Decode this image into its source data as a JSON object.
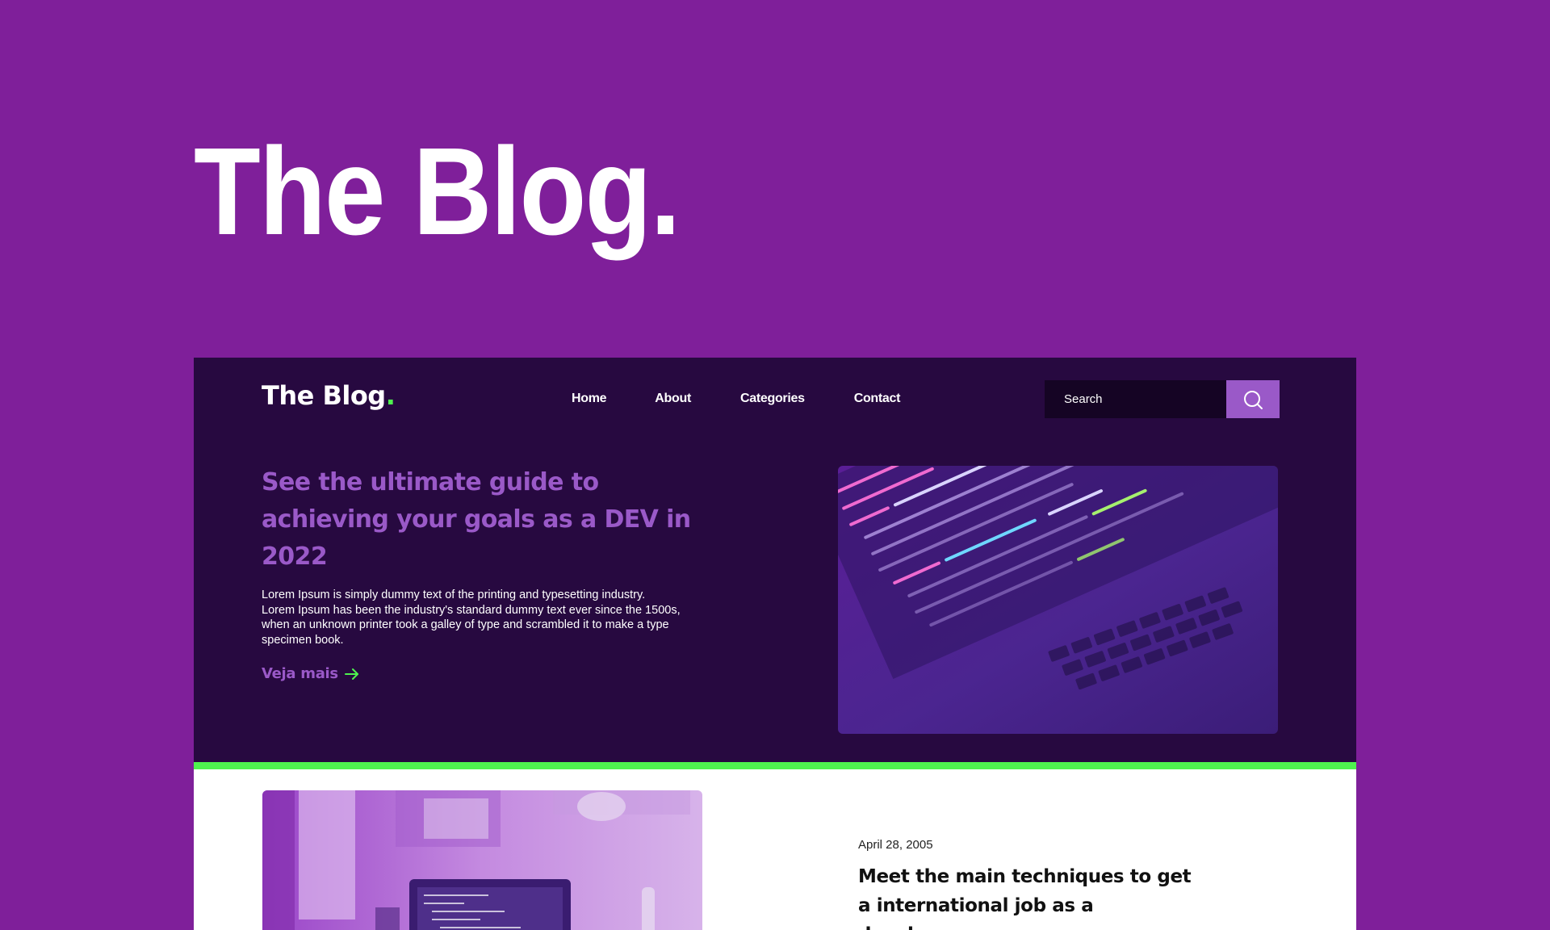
{
  "hero": {
    "title": "The Blog."
  },
  "header": {
    "logo_text": "The Blog",
    "logo_dot": ".",
    "nav": [
      "Home",
      "About",
      "Categories",
      "Contact"
    ],
    "search_placeholder": "Search"
  },
  "featured": {
    "title": "See the ultimate guide to achieving your goals as a DEV in 2022",
    "body": "Lorem Ipsum is simply dummy text of the printing and typesetting industry. Lorem Ipsum has been the industry's standard dummy text ever since the 1500s, when an unknown printer took a galley of type and scrambled it to make a type specimen book.",
    "link_label": "Veja mais",
    "image_icon": "code-laptop-image"
  },
  "post": {
    "date": "April 28, 2005",
    "title": "Meet the main techniques to get a international job as a developer",
    "image_icon": "desk-laptop-image"
  },
  "colors": {
    "page_bg": "#7f1f9a",
    "dark_bg": "#270940",
    "accent_purple": "#9a59c8",
    "accent_green": "#4ff34f",
    "search_bg": "#150424"
  }
}
